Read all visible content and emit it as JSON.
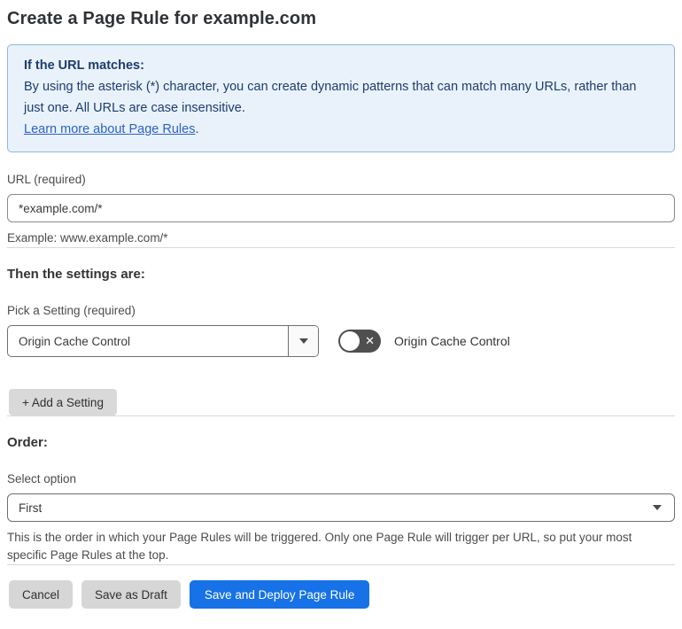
{
  "page": {
    "title": "Create a Page Rule for example.com"
  },
  "info_box": {
    "heading": "If the URL matches:",
    "body": "By using the asterisk (*) character, you can create dynamic patterns that can match many URLs, rather than just one. All URLs are case insensitive.",
    "link_label": "Learn more about Page Rules",
    "link_suffix": "."
  },
  "url_field": {
    "label": "URL (required)",
    "value": "*example.com/*",
    "helper": "Example: www.example.com/*"
  },
  "settings_section": {
    "heading": "Then the settings are:",
    "picker_label": "Pick a Setting (required)",
    "picker_value": "Origin Cache Control",
    "toggle_state": "off",
    "toggle_glyph": "✕",
    "toggle_label": "Origin Cache Control",
    "add_setting_label": "+ Add a Setting"
  },
  "order_section": {
    "heading": "Order:",
    "select_label": "Select option",
    "select_value": "First",
    "helper": "This is the order in which your Page Rules will be triggered. Only one Page Rule will trigger per URL, so put your most specific Page Rules at the top."
  },
  "footer": {
    "cancel_label": "Cancel",
    "save_draft_label": "Save as Draft",
    "save_deploy_label": "Save and Deploy Page Rule"
  },
  "colors": {
    "accent_blue": "#1672e6",
    "info_box_bg": "#e9f2fb",
    "info_box_border": "#8fb5e5",
    "info_text_navy": "#1d3c6d",
    "link_blue": "#2c62c4",
    "toggle_off_bg": "#4f4f4f",
    "gray_button_bg": "#d6d6d6"
  }
}
